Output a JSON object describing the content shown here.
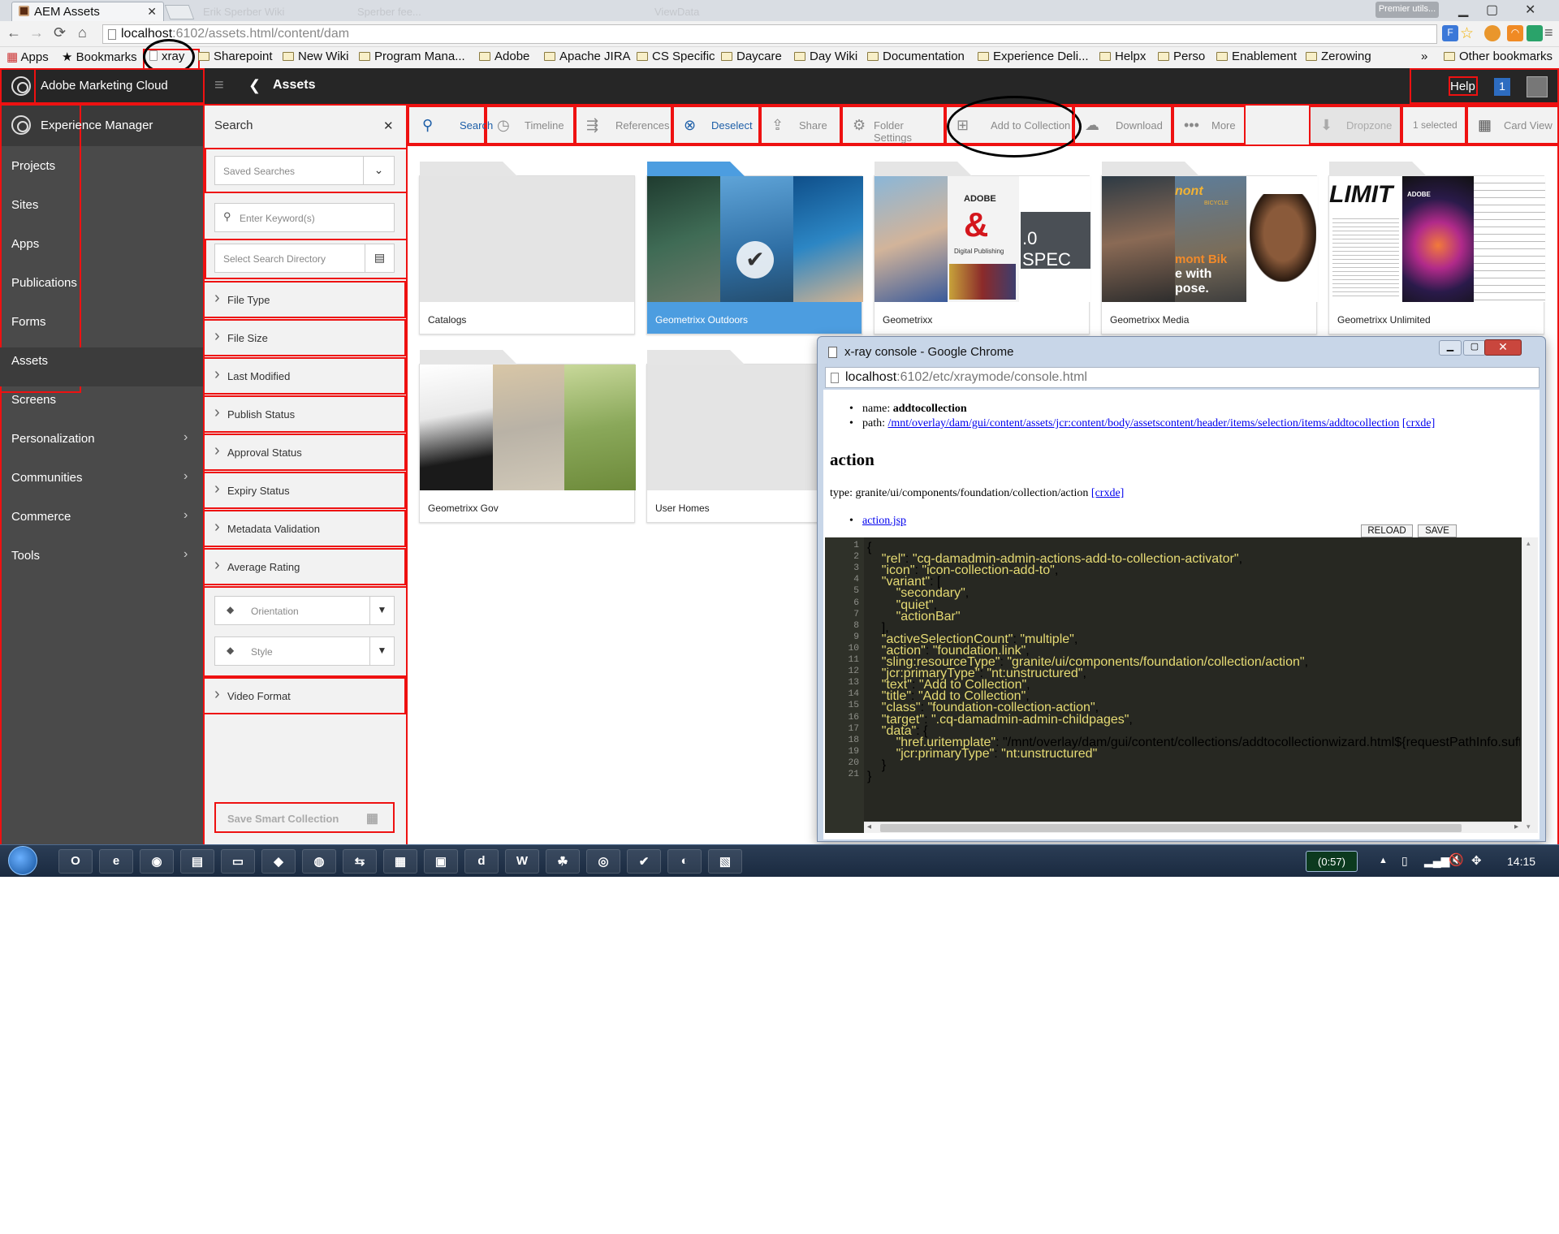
{
  "browser": {
    "tab_title": "AEM Assets",
    "tab_close": "✕",
    "ghost_tabs": [
      "Erik Sperber Wiki",
      "Sperber fee...",
      "ViewData"
    ],
    "profile": "Premier utils...",
    "url_host": "localhost",
    "url_rest": ":6102/assets.html/content/dam",
    "win_min": "▁",
    "win_max": "▢",
    "win_close": "✕",
    "nav": {
      "back": "←",
      "forward": "→",
      "reload": "⟳",
      "home": "⌂"
    },
    "menu": "≡",
    "star": "☆"
  },
  "bookmarks": {
    "apps": "Apps",
    "bookmarks": "Bookmarks",
    "xray": "xray",
    "items": [
      "Sharepoint",
      "New Wiki",
      "Program Mana...",
      "Adobe",
      "Apache JIRA",
      "CS Specific",
      "Daycare",
      "Day Wiki",
      "Documentation",
      "Experience Deli...",
      "Helpx",
      "Perso",
      "Enablement",
      "Zerowing"
    ],
    "more": "»",
    "other": "Other bookmarks"
  },
  "aem": {
    "brand": "Adobe Marketing Cloud",
    "title": "Assets",
    "help": "Help",
    "notif_count": "1",
    "back": "❮"
  },
  "leftnav": {
    "header": "Experience Manager",
    "items": [
      {
        "label": "Projects"
      },
      {
        "label": "Sites"
      },
      {
        "label": "Apps"
      },
      {
        "label": "Publications"
      },
      {
        "label": "Forms"
      },
      {
        "label": "Assets"
      },
      {
        "label": "Screens"
      },
      {
        "label": "Personalization"
      },
      {
        "label": "Communities"
      },
      {
        "label": "Commerce"
      },
      {
        "label": "Tools"
      }
    ],
    "chevron": "›"
  },
  "search": {
    "title": "Search",
    "close": "✕",
    "saved_searches": "Saved Searches",
    "keyword_placeholder": "Enter Keyword(s)",
    "directory_placeholder": "Select Search Directory",
    "filters": [
      "File Type",
      "File Size",
      "Last Modified",
      "Publish Status",
      "Approval Status",
      "Expiry Status",
      "Metadata Validation",
      "Average Rating"
    ],
    "orientation": "Orientation",
    "style": "Style",
    "video_format": "Video Format",
    "save_smart": "Save Smart Collection"
  },
  "actionbar": {
    "search": "Search",
    "timeline": "Timeline",
    "references": "References",
    "deselect": "Deselect",
    "share": "Share",
    "folder_settings": "Folder Settings",
    "add_to_collection": "Add to Collection",
    "download": "Download",
    "more": "More",
    "dropzone": "Dropzone",
    "selected": "1 selected",
    "card_view": "Card View"
  },
  "cards": [
    {
      "label": "Catalogs"
    },
    {
      "label": "Geometrixx Outdoors"
    },
    {
      "label": "Geometrixx"
    },
    {
      "label": "Geometrixx Media"
    },
    {
      "label": "Geometrixx Unlimited"
    },
    {
      "label": "Geometrixx Gov"
    },
    {
      "label": "User Homes"
    }
  ],
  "thumb_text": {
    "adobe": "ADOBE",
    "amp": "&",
    "digital": "Digital Publishing",
    "spec": ".0 SPEC",
    "mont": "mont Bik",
    "with": "e with",
    "pose": "pose.",
    "limit": "LIMIT",
    "bicycle": "BICYCLE",
    "adobe_small": "ADOBE"
  },
  "popup": {
    "title": "x-ray console - Google Chrome",
    "url_host": "localhost",
    "url_rest": ":6102/etc/xraymode/console.html",
    "name_label": "name: ",
    "name_value": "addtocollection",
    "path_label": "path: ",
    "path_value": "/mnt/overlay/dam/gui/content/assets/jcr:content/body/assetscontent/header/items/selection/items/addtocollection",
    "crxde": "[crxde]",
    "heading": "action",
    "type_label": "type: granite/ui/components/foundation/collection/action",
    "jsp": "action.jsp",
    "reload": "RELOAD",
    "save": "SAVE",
    "code_lines": [
      "{",
      "    \"rel\": \"cq-damadmin-admin-actions-add-to-collection-activator\",",
      "    \"icon\": \"icon-collection-add-to\",",
      "    \"variant\": [",
      "        \"secondary\",",
      "        \"quiet\",",
      "        \"actionBar\"",
      "    ],",
      "    \"activeSelectionCount\": \"multiple\",",
      "    \"action\": \"foundation.link\",",
      "    \"sling:resourceType\": \"granite/ui/components/foundation/collection/action\",",
      "    \"jcr:primaryType\": \"nt:unstructured\",",
      "    \"text\": \"Add to Collection\",",
      "    \"title\": \"Add to Collection\",",
      "    \"class\": \"foundation-collection-action\",",
      "    \"target\": \".cq-damadmin-admin-childpages\",",
      "    \"data\": {",
      "        \"href.uritemplate\": \"/mnt/overlay/dam/gui/content/collections/addtocollectionwizard.html${requestPathInfo.suffix}{?",
      "        \"jcr:primaryType\": \"nt:unstructured\"",
      "    }",
      "}"
    ],
    "line_numbers": [
      "1",
      "2",
      "3",
      "4",
      "5",
      "6",
      "7",
      "8",
      "9",
      "10",
      "11",
      "12",
      "13",
      "14",
      "15",
      "16",
      "17",
      "18",
      "19",
      "20",
      "21"
    ]
  },
  "taskbar": {
    "timer": "(0:57)",
    "clock": "14:15",
    "apps": [
      "O",
      "e",
      "◉",
      "▤",
      "▭",
      "◆",
      "◍",
      "⇆",
      "▦",
      "▣",
      "d",
      "W",
      "☘",
      "◎",
      "✔",
      "◐",
      "▧"
    ]
  },
  "colors": {
    "accent_blue": "#1e5fa8",
    "selected_card": "#4c9de0",
    "annotation_red": "#ee1111",
    "nav_bg": "#4a4a4a",
    "header_bg": "#262626"
  }
}
